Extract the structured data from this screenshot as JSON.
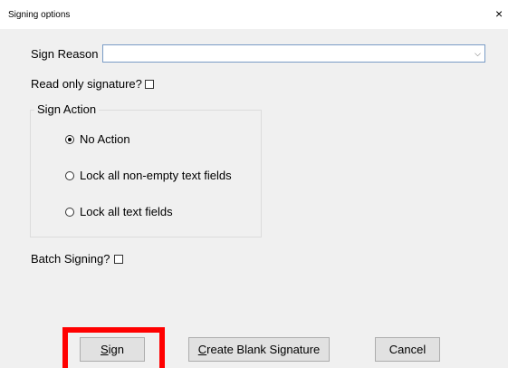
{
  "window": {
    "title": "Signing options",
    "close_glyph": "×"
  },
  "sign_reason": {
    "label": "Sign Reason",
    "value": "",
    "dropdown_glyph": "⌵"
  },
  "read_only": {
    "label": "Read only signature?",
    "checked": false
  },
  "sign_action": {
    "label": "Sign Action",
    "options": [
      {
        "label": "No Action",
        "selected": true
      },
      {
        "label": "Lock all non-empty text fields",
        "selected": false
      },
      {
        "label": "Lock all text fields",
        "selected": false
      }
    ]
  },
  "batch": {
    "label": "Batch Signing?",
    "checked": false
  },
  "buttons": {
    "sign_mnemonic": "S",
    "sign_rest": "ign",
    "create_mnemonic": "C",
    "create_rest": "reate Blank Signature",
    "cancel": "Cancel"
  },
  "highlight_color": "#ff0000"
}
